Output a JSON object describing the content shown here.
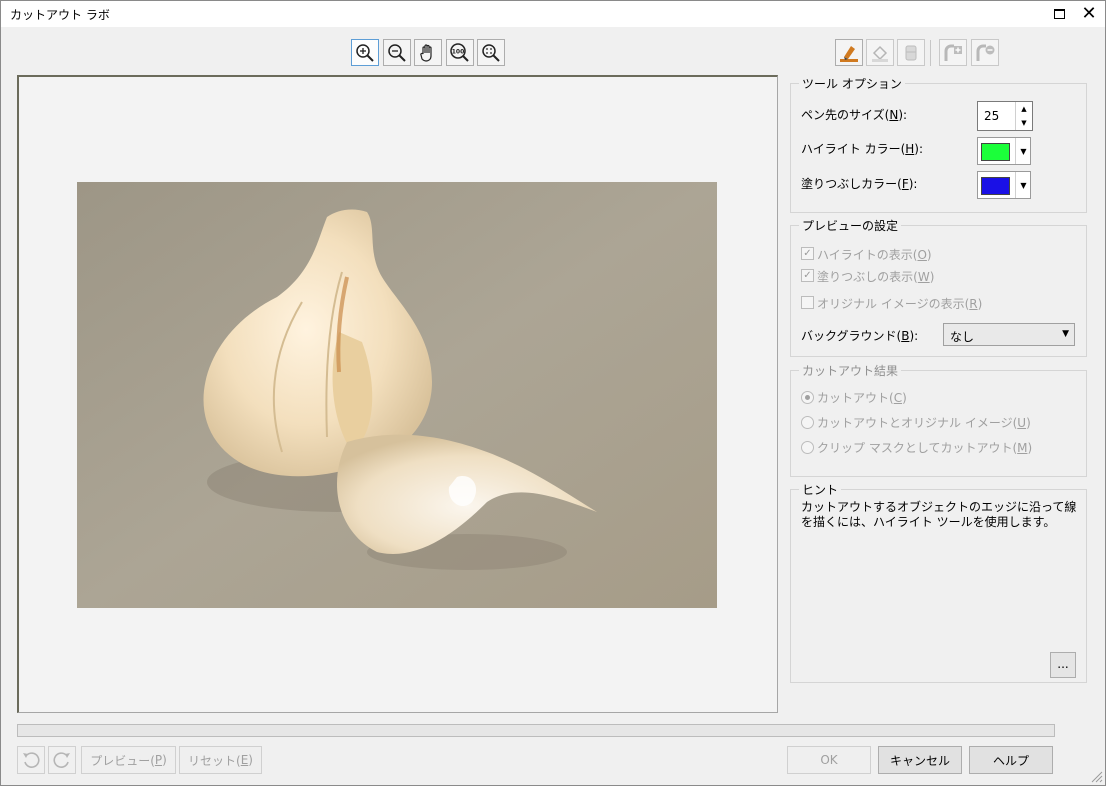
{
  "window": {
    "title": "カットアウト ラボ"
  },
  "toolbar": {
    "left_tools": [
      {
        "name": "zoom-in-icon"
      },
      {
        "name": "zoom-out-icon"
      },
      {
        "name": "pan-hand-icon"
      },
      {
        "name": "zoom-100-icon",
        "text": "100"
      },
      {
        "name": "zoom-fit-icon"
      }
    ],
    "right_tools": [
      {
        "name": "highlighter-icon"
      },
      {
        "name": "fill-bucket-icon"
      },
      {
        "name": "eraser-icon"
      },
      {
        "name": "add-detail-icon"
      },
      {
        "name": "remove-detail-icon"
      }
    ]
  },
  "tool_options": {
    "title": "ツール オプション",
    "nib_size_label": "ペン先のサイズ(",
    "nib_size_key": "N",
    "nib_size_value": "25",
    "highlight_label": "ハイライト  カラー(",
    "highlight_key": "H",
    "highlight_color": "#1bff3a",
    "fill_label": "塗りつぶしカラー(",
    "fill_key": "F",
    "fill_color": "#1a10e6"
  },
  "preview_settings": {
    "title": "プレビューの設定",
    "show_highlight_label": "ハイライトの表示(",
    "show_highlight_key": "O",
    "show_highlight_checked": true,
    "show_fill_label": "塗りつぶしの表示(",
    "show_fill_key": "W",
    "show_fill_checked": true,
    "show_original_label": "オリジナル イメージの表示(",
    "show_original_key": "R",
    "show_original_checked": false,
    "background_label": "バックグラウンド(",
    "background_key": "B",
    "background_value": "なし"
  },
  "cutout_result": {
    "title": "カットアウト結果",
    "opt1_label": "カットアウト(",
    "opt1_key": "C",
    "opt2_label": "カットアウトとオリジナル イメージ(",
    "opt2_key": "U",
    "opt3_label": "クリップ マスクとしてカットアウト(",
    "opt3_key": "M",
    "selected": 1
  },
  "hint": {
    "title": "ヒント",
    "text": "カットアウトするオブジェクトのエッジに沿って線を描くには、ハイライト ツールを使用します。",
    "more_label": "..."
  },
  "bottom": {
    "undo_icon": "undo-icon",
    "redo_icon": "redo-icon",
    "preview_label": "プレビュー(",
    "preview_key": "P",
    "reset_label": "リセット(",
    "reset_key": "E",
    "ok_label": "OK",
    "cancel_label": "キャンセル",
    "help_label": "ヘルプ"
  }
}
